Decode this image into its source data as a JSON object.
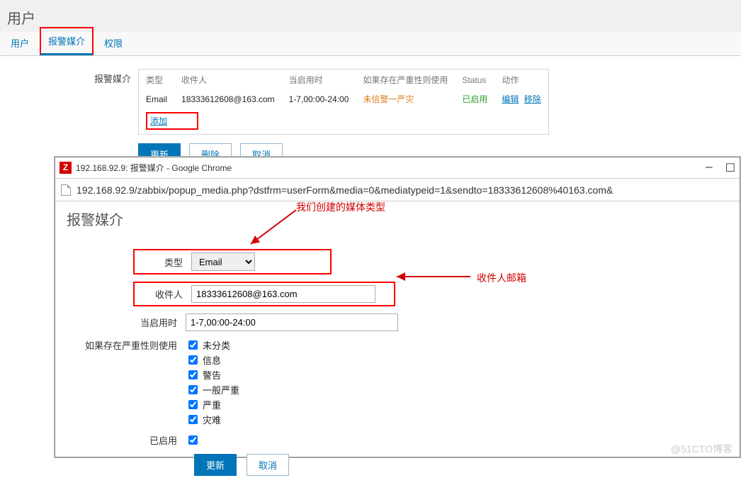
{
  "page": {
    "title": "用户"
  },
  "tabs": {
    "t0": "用户",
    "t1": "报警媒介",
    "t2": "权限"
  },
  "media": {
    "section_label": "报警媒介",
    "headers": {
      "type": "类型",
      "recipient": "收件人",
      "when": "当启用时",
      "severity": "如果存在严重性则使用",
      "status": "Status",
      "action": "动作"
    },
    "row": {
      "type": "Email",
      "recipient": "18333612608@163.com",
      "when": "1-7,00:00-24:00",
      "severity": "未信警一严灾",
      "status": "已启用",
      "edit": "编辑",
      "remove": "移除"
    },
    "add": "添加"
  },
  "buttons": {
    "update": "更新",
    "delete": "删除",
    "cancel": "取消"
  },
  "popup": {
    "wintitle": "192.168.92.9: 报警媒介 - Google Chrome",
    "url": "192.168.92.9/zabbix/popup_media.php?dstfrm=userForm&media=0&mediatypeid=1&sendto=18333612608%40163.com&",
    "heading": "报警媒介",
    "labels": {
      "type": "类型",
      "recipient": "收件人",
      "when": "当启用时",
      "severity": "如果存在严重性则使用",
      "enabled": "已启用"
    },
    "type_value": "Email",
    "recipient_value": "18333612608@163.com",
    "when_value": "1-7,00:00-24:00",
    "severities": {
      "s0": "未分类",
      "s1": "信息",
      "s2": "警告",
      "s3": "一般严重",
      "s4": "严重",
      "s5": "灾难"
    },
    "update": "更新",
    "cancel": "取消"
  },
  "annotations": {
    "type_note": "我们创建的媒体类型",
    "recipient_note": "收件人邮箱"
  },
  "watermark": "@51CTO博客"
}
